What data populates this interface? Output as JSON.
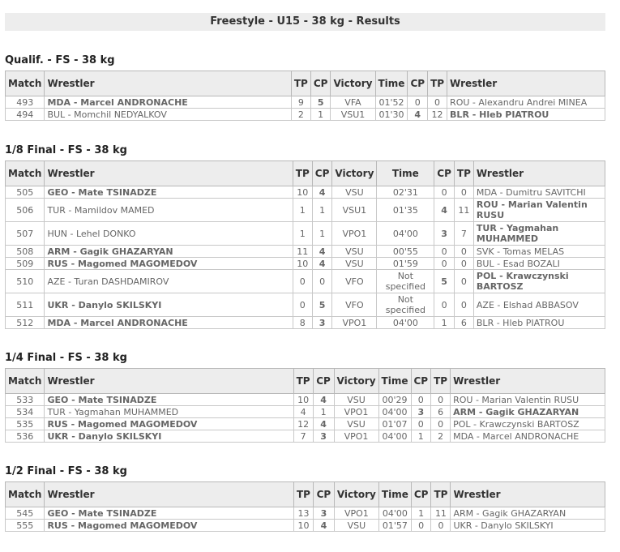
{
  "title": "Freestyle - U15 - 38 kg - Results",
  "headers": [
    "Match",
    "Wrestler",
    "TP",
    "CP",
    "Victory",
    "Time",
    "CP",
    "TP",
    "Wrestler"
  ],
  "sections": [
    {
      "title": "Qualif. - FS - 38 kg",
      "rows": [
        {
          "match": "493",
          "w1": "MDA - Marcel ANDRONACHE",
          "w1win": true,
          "tp1": "9",
          "cp1": "5",
          "vic": "VFA",
          "time": "01'52",
          "cp2": "0",
          "tp2": "0",
          "w2": "ROU - Alexandru Andrei MINEA",
          "w2win": false
        },
        {
          "match": "494",
          "w1": "BUL - Momchil NEDYALKOV",
          "w1win": false,
          "tp1": "2",
          "cp1": "1",
          "vic": "VSU1",
          "time": "01'30",
          "cp2": "4",
          "tp2": "12",
          "w2": "BLR - Hleb PIATROU",
          "w2win": true
        }
      ]
    },
    {
      "title": "1/8 Final - FS - 38 kg",
      "rows": [
        {
          "match": "505",
          "w1": "GEO - Mate TSINADZE",
          "w1win": true,
          "tp1": "10",
          "cp1": "4",
          "vic": "VSU",
          "time": "02'31",
          "cp2": "0",
          "tp2": "0",
          "w2": "MDA - Dumitru SAVITCHI",
          "w2win": false
        },
        {
          "match": "506",
          "w1": "TUR - Mamildov MAMED",
          "w1win": false,
          "tp1": "1",
          "cp1": "1",
          "vic": "VSU1",
          "time": "01'35",
          "cp2": "4",
          "tp2": "11",
          "w2": "ROU - Marian Valentin RUSU",
          "w2win": true
        },
        {
          "match": "507",
          "w1": "HUN - Lehel DONKO",
          "w1win": false,
          "tp1": "1",
          "cp1": "1",
          "vic": "VPO1",
          "time": "04'00",
          "cp2": "3",
          "tp2": "7",
          "w2": "TUR - Yagmahan MUHAMMED",
          "w2win": true
        },
        {
          "match": "508",
          "w1": "ARM - Gagik GHAZARYAN",
          "w1win": true,
          "tp1": "11",
          "cp1": "4",
          "vic": "VSU",
          "time": "00'55",
          "cp2": "0",
          "tp2": "0",
          "w2": "SVK - Tomas MELAS",
          "w2win": false
        },
        {
          "match": "509",
          "w1": "RUS - Magomed MAGOMEDOV",
          "w1win": true,
          "tp1": "10",
          "cp1": "4",
          "vic": "VSU",
          "time": "01'59",
          "cp2": "0",
          "tp2": "0",
          "w2": "BUL - Esad BOZALI",
          "w2win": false
        },
        {
          "match": "510",
          "w1": "AZE - Turan DASHDAMIROV",
          "w1win": false,
          "tp1": "0",
          "cp1": "0",
          "vic": "VFO",
          "time": "Not specified",
          "cp2": "5",
          "tp2": "0",
          "w2": "POL - Krawczynski BARTOSZ",
          "w2win": true
        },
        {
          "match": "511",
          "w1": "UKR - Danylo SKILSKYI",
          "w1win": true,
          "tp1": "0",
          "cp1": "5",
          "vic": "VFO",
          "time": "Not specified",
          "cp2": "0",
          "tp2": "0",
          "w2": "AZE - Elshad ABBASOV",
          "w2win": false
        },
        {
          "match": "512",
          "w1": "MDA - Marcel ANDRONACHE",
          "w1win": true,
          "tp1": "8",
          "cp1": "3",
          "vic": "VPO1",
          "time": "04'00",
          "cp2": "1",
          "tp2": "6",
          "w2": "BLR - Hleb PIATROU",
          "w2win": false
        }
      ]
    },
    {
      "title": "1/4 Final - FS - 38 kg",
      "rows": [
        {
          "match": "533",
          "w1": "GEO - Mate TSINADZE",
          "w1win": true,
          "tp1": "10",
          "cp1": "4",
          "vic": "VSU",
          "time": "00'29",
          "cp2": "0",
          "tp2": "0",
          "w2": "ROU - Marian Valentin RUSU",
          "w2win": false
        },
        {
          "match": "534",
          "w1": "TUR - Yagmahan MUHAMMED",
          "w1win": false,
          "tp1": "4",
          "cp1": "1",
          "vic": "VPO1",
          "time": "04'00",
          "cp2": "3",
          "tp2": "6",
          "w2": "ARM - Gagik GHAZARYAN",
          "w2win": true
        },
        {
          "match": "535",
          "w1": "RUS - Magomed MAGOMEDOV",
          "w1win": true,
          "tp1": "12",
          "cp1": "4",
          "vic": "VSU",
          "time": "01'07",
          "cp2": "0",
          "tp2": "0",
          "w2": "POL - Krawczynski BARTOSZ",
          "w2win": false
        },
        {
          "match": "536",
          "w1": "UKR - Danylo SKILSKYI",
          "w1win": true,
          "tp1": "7",
          "cp1": "3",
          "vic": "VPO1",
          "time": "04'00",
          "cp2": "1",
          "tp2": "2",
          "w2": "MDA - Marcel ANDRONACHE",
          "w2win": false
        }
      ]
    },
    {
      "title": "1/2 Final - FS - 38 kg",
      "rows": [
        {
          "match": "545",
          "w1": "GEO - Mate TSINADZE",
          "w1win": true,
          "tp1": "13",
          "cp1": "3",
          "vic": "VPO1",
          "time": "04'00",
          "cp2": "1",
          "tp2": "11",
          "w2": "ARM - Gagik GHAZARYAN",
          "w2win": false
        },
        {
          "match": "555",
          "w1": "RUS - Magomed MAGOMEDOV",
          "w1win": true,
          "tp1": "10",
          "cp1": "4",
          "vic": "VSU",
          "time": "01'57",
          "cp2": "0",
          "tp2": "0",
          "w2": "UKR - Danylo SKILSKYI",
          "w2win": false
        }
      ]
    }
  ]
}
